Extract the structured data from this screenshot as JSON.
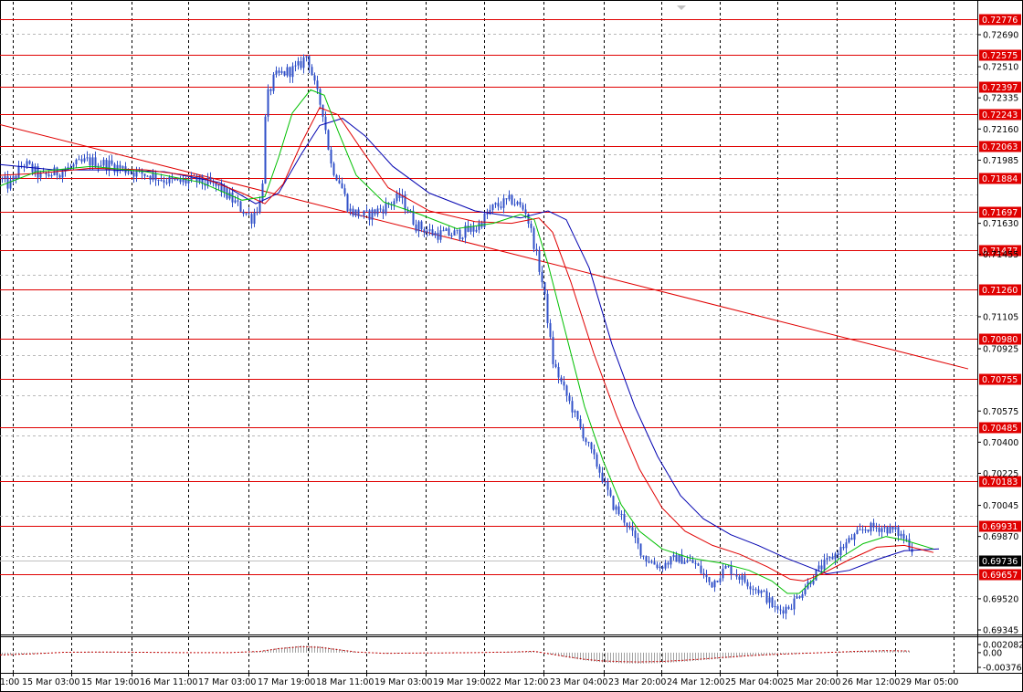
{
  "chart_data": {
    "type": "candlestick",
    "colors": {
      "candles": "#3050c8",
      "ma_fast": "#00c000",
      "ma_mid": "#e00000",
      "ma_slow": "#0000b0",
      "levels": "#e00000",
      "trendline": "#e00000",
      "current_label_bg": "#000000",
      "oscillator": "#c00000"
    },
    "price_axis_ticks": [
      "0.72690",
      "0.72510",
      "0.72335",
      "0.72160",
      "0.71985",
      "0.71630",
      "0.71455",
      "0.71105",
      "0.70925",
      "0.70575",
      "0.70400",
      "0.70225",
      "0.70045",
      "0.69870",
      "0.69520",
      "0.69345"
    ],
    "levels": [
      "0.72776",
      "0.72575",
      "0.72397",
      "0.72243",
      "0.72063",
      "0.71884",
      "0.71697",
      "0.71477",
      "0.71260",
      "0.70980",
      "0.70755",
      "0.70485",
      "0.70183",
      "0.69931",
      "0.69657"
    ],
    "current_price": "0.69736",
    "x_labels": [
      "1:00",
      "15 Mar 03:00",
      "15 Mar 19:00",
      "16 Mar 11:00",
      "17 Mar 03:00",
      "17 Mar 19:00",
      "18 Mar 11:00",
      "19 Mar 03:00",
      "19 Mar 19:00",
      "22 Mar 12:00",
      "23 Mar 04:00",
      "23 Mar 20:00",
      "24 Mar 12:00",
      "25 Mar 04:00",
      "25 Mar 20:00",
      "26 Mar 12:00",
      "29 Mar 05:00"
    ],
    "price_path": [
      [
        0,
        0.7188
      ],
      [
        10,
        0.7184
      ],
      [
        25,
        0.7197
      ],
      [
        45,
        0.7189
      ],
      [
        70,
        0.7193
      ],
      [
        95,
        0.7198
      ],
      [
        120,
        0.7196
      ],
      [
        145,
        0.7192
      ],
      [
        165,
        0.719
      ],
      [
        190,
        0.7186
      ],
      [
        215,
        0.7187
      ],
      [
        240,
        0.7183
      ],
      [
        262,
        0.7172
      ],
      [
        275,
        0.7166
      ],
      [
        286,
        0.7177
      ],
      [
        291,
        0.7232
      ],
      [
        300,
        0.7245
      ],
      [
        312,
        0.7248
      ],
      [
        325,
        0.725
      ],
      [
        336,
        0.7258
      ],
      [
        345,
        0.7238
      ],
      [
        353,
        0.7226
      ],
      [
        362,
        0.7196
      ],
      [
        372,
        0.7186
      ],
      [
        382,
        0.717
      ],
      [
        400,
        0.7167
      ],
      [
        420,
        0.7172
      ],
      [
        438,
        0.7178
      ],
      [
        455,
        0.7162
      ],
      [
        475,
        0.7157
      ],
      [
        500,
        0.7157
      ],
      [
        520,
        0.716
      ],
      [
        540,
        0.7172
      ],
      [
        560,
        0.7176
      ],
      [
        575,
        0.717
      ],
      [
        585,
        0.715
      ],
      [
        595,
        0.7125
      ],
      [
        605,
        0.7085
      ],
      [
        615,
        0.7072
      ],
      [
        625,
        0.706
      ],
      [
        640,
        0.7042
      ],
      [
        655,
        0.7025
      ],
      [
        670,
        0.7005
      ],
      [
        685,
        0.6995
      ],
      [
        705,
        0.6975
      ],
      [
        722,
        0.697
      ],
      [
        740,
        0.6975
      ],
      [
        760,
        0.6972
      ],
      [
        778,
        0.696
      ],
      [
        795,
        0.697
      ],
      [
        815,
        0.6962
      ],
      [
        835,
        0.6955
      ],
      [
        850,
        0.6945
      ],
      [
        865,
        0.6948
      ],
      [
        880,
        0.6958
      ],
      [
        895,
        0.6968
      ],
      [
        910,
        0.6975
      ],
      [
        930,
        0.6985
      ],
      [
        948,
        0.6992
      ],
      [
        965,
        0.6992
      ],
      [
        980,
        0.699
      ],
      [
        992,
        0.6985
      ],
      [
        1000,
        0.6978
      ]
    ],
    "ma_fast": [
      [
        0,
        0.7184
      ],
      [
        40,
        0.7192
      ],
      [
        100,
        0.7195
      ],
      [
        160,
        0.7192
      ],
      [
        220,
        0.7186
      ],
      [
        265,
        0.7176
      ],
      [
        290,
        0.7178
      ],
      [
        305,
        0.72
      ],
      [
        320,
        0.7225
      ],
      [
        340,
        0.7238
      ],
      [
        355,
        0.7235
      ],
      [
        370,
        0.7215
      ],
      [
        390,
        0.719
      ],
      [
        420,
        0.7175
      ],
      [
        460,
        0.7168
      ],
      [
        500,
        0.716
      ],
      [
        540,
        0.7163
      ],
      [
        570,
        0.7168
      ],
      [
        585,
        0.7165
      ],
      [
        600,
        0.714
      ],
      [
        620,
        0.71
      ],
      [
        640,
        0.706
      ],
      [
        660,
        0.703
      ],
      [
        680,
        0.7005
      ],
      [
        700,
        0.699
      ],
      [
        725,
        0.698
      ],
      [
        755,
        0.6975
      ],
      [
        790,
        0.6972
      ],
      [
        820,
        0.6968
      ],
      [
        845,
        0.6962
      ],
      [
        862,
        0.6955
      ],
      [
        875,
        0.6955
      ],
      [
        895,
        0.6965
      ],
      [
        920,
        0.6975
      ],
      [
        945,
        0.6983
      ],
      [
        970,
        0.6987
      ],
      [
        990,
        0.6985
      ],
      [
        1022,
        0.698
      ]
    ],
    "ma_mid": [
      [
        0,
        0.719
      ],
      [
        40,
        0.7191
      ],
      [
        100,
        0.7194
      ],
      [
        160,
        0.7193
      ],
      [
        220,
        0.7189
      ],
      [
        265,
        0.718
      ],
      [
        290,
        0.7174
      ],
      [
        310,
        0.7185
      ],
      [
        330,
        0.7208
      ],
      [
        350,
        0.7228
      ],
      [
        370,
        0.7224
      ],
      [
        395,
        0.7205
      ],
      [
        425,
        0.7183
      ],
      [
        470,
        0.717
      ],
      [
        520,
        0.7164
      ],
      [
        560,
        0.7163
      ],
      [
        590,
        0.7166
      ],
      [
        605,
        0.7158
      ],
      [
        625,
        0.713
      ],
      [
        650,
        0.709
      ],
      [
        675,
        0.7055
      ],
      [
        700,
        0.7025
      ],
      [
        725,
        0.7003
      ],
      [
        750,
        0.699
      ],
      [
        780,
        0.6982
      ],
      [
        810,
        0.6977
      ],
      [
        840,
        0.697
      ],
      [
        865,
        0.6963
      ],
      [
        880,
        0.6962
      ],
      [
        900,
        0.6966
      ],
      [
        930,
        0.6974
      ],
      [
        960,
        0.6981
      ],
      [
        990,
        0.6982
      ],
      [
        1022,
        0.6978
      ]
    ],
    "ma_slow": [
      [
        0,
        0.7196
      ],
      [
        60,
        0.7193
      ],
      [
        120,
        0.7193
      ],
      [
        180,
        0.7192
      ],
      [
        240,
        0.7186
      ],
      [
        280,
        0.7174
      ],
      [
        305,
        0.718
      ],
      [
        330,
        0.7202
      ],
      [
        350,
        0.7218
      ],
      [
        375,
        0.7222
      ],
      [
        400,
        0.7212
      ],
      [
        430,
        0.7195
      ],
      [
        470,
        0.718
      ],
      [
        520,
        0.717
      ],
      [
        570,
        0.7166
      ],
      [
        600,
        0.717
      ],
      [
        620,
        0.7165
      ],
      [
        645,
        0.7138
      ],
      [
        670,
        0.7095
      ],
      [
        695,
        0.706
      ],
      [
        720,
        0.7032
      ],
      [
        745,
        0.701
      ],
      [
        770,
        0.6997
      ],
      [
        800,
        0.6988
      ],
      [
        830,
        0.6982
      ],
      [
        860,
        0.6975
      ],
      [
        885,
        0.697
      ],
      [
        905,
        0.6966
      ],
      [
        930,
        0.6968
      ],
      [
        960,
        0.6974
      ],
      [
        990,
        0.6979
      ],
      [
        1028,
        0.698
      ]
    ],
    "trendline_points": [
      [
        0,
        0.72185
      ],
      [
        1060,
        0.70812
      ]
    ],
    "oscillator": {
      "labels": [
        "0.002082",
        "0.00",
        "-0.003768"
      ],
      "profile": [
        [
          0,
          -0.0007
        ],
        [
          40,
          -0.0003
        ],
        [
          70,
          0.0001
        ],
        [
          110,
          0.0002
        ],
        [
          160,
          0.0001
        ],
        [
          200,
          0.0
        ],
        [
          250,
          0.0
        ],
        [
          285,
          0.0004
        ],
        [
          305,
          0.0012
        ],
        [
          330,
          0.0018
        ],
        [
          350,
          0.0016
        ],
        [
          370,
          0.0009
        ],
        [
          390,
          0.0002
        ],
        [
          420,
          -0.0002
        ],
        [
          470,
          -0.0001
        ],
        [
          520,
          0.0
        ],
        [
          560,
          0.0002
        ],
        [
          585,
          0.0004
        ],
        [
          600,
          -0.0003
        ],
        [
          620,
          -0.0012
        ],
        [
          640,
          -0.002
        ],
        [
          660,
          -0.0025
        ],
        [
          680,
          -0.0027
        ],
        [
          700,
          -0.0028
        ],
        [
          730,
          -0.0026
        ],
        [
          760,
          -0.0021
        ],
        [
          790,
          -0.0015
        ],
        [
          820,
          -0.0009
        ],
        [
          850,
          -0.0005
        ],
        [
          880,
          -0.0002
        ],
        [
          910,
          0.0001
        ],
        [
          940,
          0.0004
        ],
        [
          970,
          0.0006
        ],
        [
          995,
          0.0005
        ]
      ]
    }
  }
}
